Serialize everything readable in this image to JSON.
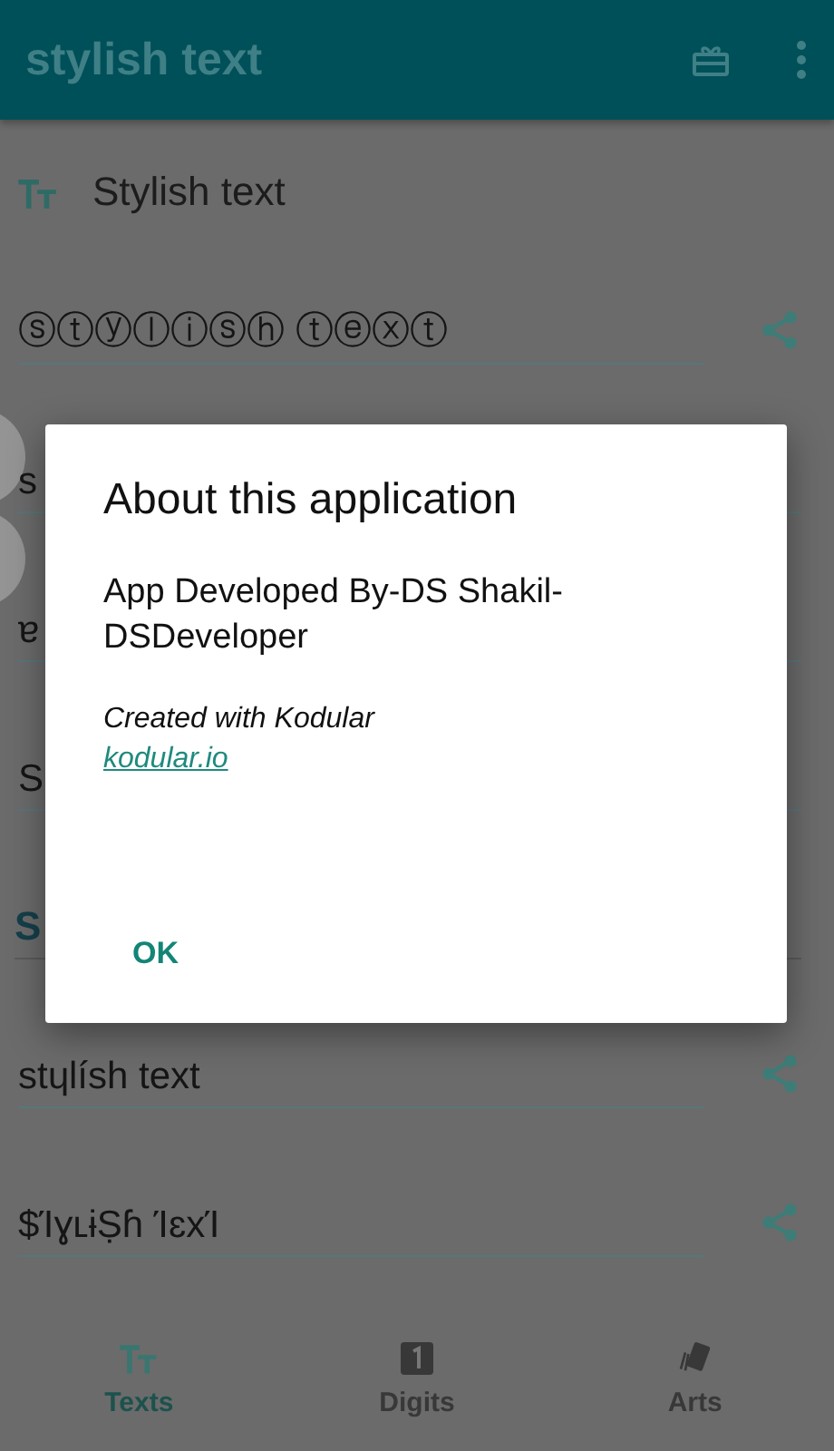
{
  "app_bar": {
    "title": "stylish text"
  },
  "section": {
    "title": "Stylish text"
  },
  "rows": [
    {
      "kind": "field",
      "text": "ⓢⓣⓨⓛⓘⓢⓗ ⓣⓔⓧⓣ",
      "share": true
    },
    {
      "kind": "field",
      "text": "s",
      "share": false
    },
    {
      "kind": "field",
      "text": "ɐ",
      "share": false
    },
    {
      "kind": "field",
      "text": "S",
      "share": false
    },
    {
      "kind": "heading",
      "text": "S",
      "share": false
    },
    {
      "kind": "field",
      "text": "stɥlísh text",
      "share": true
    },
    {
      "kind": "field",
      "text": "$ΊɣʟɨṢɦ ΊɛxΊ",
      "share": true
    }
  ],
  "dialog": {
    "title": "About this application",
    "message": "App Developed By-DS Shakil-DSDeveloper",
    "note": "Created with Kodular",
    "link": "kodular.io",
    "button": "OK"
  },
  "bottom_nav": [
    {
      "kind": "texts",
      "label": "Texts",
      "selected": true
    },
    {
      "kind": "digits",
      "label": "Digits",
      "selected": false
    },
    {
      "kind": "arts",
      "label": "Arts",
      "selected": false
    }
  ]
}
